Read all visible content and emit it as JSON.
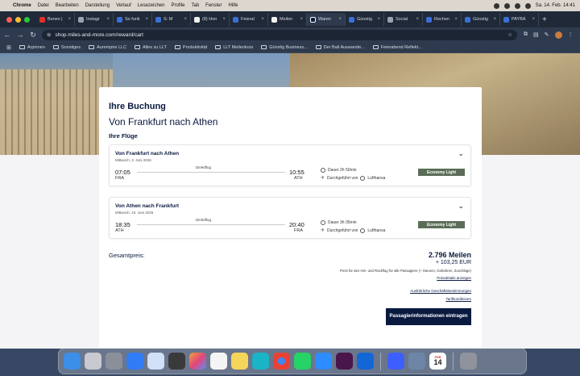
{
  "menubar": {
    "app_name": "Chrome",
    "items": [
      "Datei",
      "Bearbeiten",
      "Darstellung",
      "Verlauf",
      "Lesezeichen",
      "Profile",
      "Tab",
      "Fenster",
      "Hilfe"
    ],
    "datetime": "Sa. 14. Feb.  14:41"
  },
  "tabs": [
    {
      "label": "Bones |",
      "favicon_color": "#e0312d"
    },
    {
      "label": "Instagr",
      "favicon_color": "#9aa3b0"
    },
    {
      "label": "So funk",
      "favicon_color": "#3b6fd8"
    },
    {
      "label": "S: M",
      "favicon_color": "#3b6fd8"
    },
    {
      "label": "(8) Hon",
      "favicon_color": "#f1f1f1"
    },
    {
      "label": "Feieral",
      "favicon_color": "#3b6fd8"
    },
    {
      "label": "Meilen",
      "favicon_color": "#f1f1f1"
    },
    {
      "label": "Waren",
      "favicon_color": "#0a1a3f",
      "active": true
    },
    {
      "label": "Günstig",
      "favicon_color": "#3b6fd8"
    },
    {
      "label": "Social",
      "favicon_color": "#9aa3b0"
    },
    {
      "label": "Rechen",
      "favicon_color": "#3b6fd8"
    },
    {
      "label": "Günstig",
      "favicon_color": "#3b6fd8"
    },
    {
      "label": "PAYBA",
      "favicon_color": "#3b6fd8"
    }
  ],
  "address": {
    "url": "shop.miles-and-more.com/reward/cart"
  },
  "bookmarks": [
    "Arpinnen",
    "Sonstiges",
    "Aurempire LLC",
    "Alles zu LLT",
    "Produktivität",
    "LLT Meilenkurs",
    "Günstig Business...",
    "Der Bali Auswande...",
    "Feierabend Reflekt..."
  ],
  "booking": {
    "title": "Ihre Buchung",
    "route": "Von Frankfurt nach Athen",
    "flights_heading": "Ihre Flüge",
    "flights": [
      {
        "title": "Von Frankfurt nach Athen",
        "date": "Mittwoch, 3. Juni 2026",
        "dep_time": "07:05",
        "dep_code": "FRA",
        "arr_time": "10:55",
        "arr_code": "ATH",
        "direct": "Direktflug",
        "duration": "Dauer 2h 50min",
        "operator": "Durchgeführt von",
        "airline": "Lufthansa",
        "fare": "Economy Light"
      },
      {
        "title": "Von Athen nach Frankfurt",
        "date": "Mittwoch, 10. Juni 2026",
        "dep_time": "18:35",
        "dep_code": "ATH",
        "arr_time": "20:40",
        "arr_code": "FRA",
        "direct": "Direktflug",
        "duration": "Dauer 3h 05min",
        "operator": "Durchgeführt von",
        "airline": "Lufthansa",
        "fare": "Economy Light"
      }
    ],
    "total_label": "Gesamtpreis:",
    "total_miles": "2.796 Meilen",
    "total_eur": "+ 103,25 EUR",
    "price_note": "Preis für den Hin- und Rückflug für alle Passagiere (+ Steuern, Gebühren, Zuschläge)",
    "price_details_link": "Preisdetails anzeigen",
    "terms_link": "Ausführliche Geschäftsbestimmungen",
    "tariff_link": "Tarifkonditionen",
    "cta": "Passagierinformationen eintragen"
  },
  "dock": [
    {
      "name": "Finder",
      "color": "#3c8ee8"
    },
    {
      "name": "Launchpad",
      "color": "#c9c9d1"
    },
    {
      "name": "Systemeinstellungen",
      "color": "#8a8f99"
    },
    {
      "name": "App Store",
      "color": "#2f7cf6"
    },
    {
      "name": "Vorschau",
      "color": "#cfe0f7"
    },
    {
      "name": "Rechner",
      "color": "#3a3a3a"
    },
    {
      "name": "Fotos",
      "color": "#f2a03d"
    },
    {
      "name": "Erinnerungen",
      "color": "#f4f4f4"
    },
    {
      "name": "Notizen",
      "color": "#f6d65a"
    },
    {
      "name": "Canva",
      "color": "#1bb3c6"
    },
    {
      "name": "Chrome",
      "color": "#e94235"
    },
    {
      "name": "WhatsApp",
      "color": "#25d366"
    },
    {
      "name": "Zoom",
      "color": "#2d8cff"
    },
    {
      "name": "Slack",
      "color": "#4a154b"
    },
    {
      "name": "Trello",
      "color": "#1366d6"
    },
    {
      "name": "Nord",
      "color": "#3e5fff"
    },
    {
      "name": "Vorschau2",
      "color": "#6d86a8"
    },
    {
      "name": "Kalender",
      "color": "#ffffff"
    },
    {
      "name": "Papierkorb",
      "color": "#8f949c"
    }
  ],
  "dock_calendar": {
    "month": "FEB",
    "day": "14"
  }
}
